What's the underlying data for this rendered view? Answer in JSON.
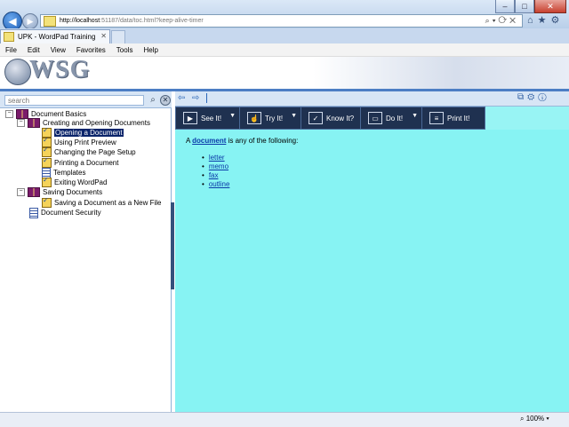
{
  "browser": {
    "address_host": "http://localhost",
    "address_path": ":51187/data/toc.html?keep-alive-timer",
    "tab_title": "UPK - WordPad Training",
    "menu": [
      "File",
      "Edit",
      "View",
      "Favorites",
      "Tools",
      "Help"
    ],
    "zoom": "100%"
  },
  "header": {
    "logo_text": "WSG"
  },
  "search": {
    "placeholder": "search"
  },
  "tree": {
    "root": "Document Basics",
    "group1": "Creating and Opening Documents",
    "group1_items": [
      "Opening a Document",
      "Using Print Preview",
      "Changing the Page Setup",
      "Printing a Document",
      "Templates",
      "Exiting WordPad"
    ],
    "group2": "Saving Documents",
    "group2_items": [
      "Saving a Document as a New File"
    ],
    "extra": "Document Security",
    "selected": "Opening a Document"
  },
  "modes": [
    "See It!",
    "Try It!",
    "Know It?",
    "Do It!",
    "Print It!"
  ],
  "content": {
    "lead_prefix": "A",
    "lead_link": "document",
    "lead_suffix": "is any of the following:",
    "items": [
      "letter",
      "memo",
      "fax",
      "outline"
    ]
  },
  "colors": {
    "content_bg": "#87f3f3",
    "toolbar_bg": "#1f3150",
    "selection": "#0a246a"
  }
}
